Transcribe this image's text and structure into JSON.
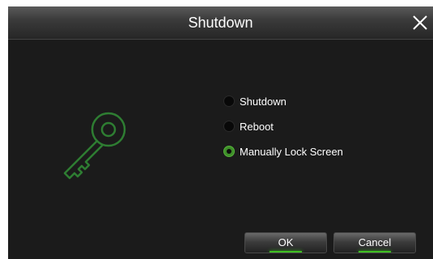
{
  "dialog": {
    "title": "Shutdown",
    "close_icon": "close-icon"
  },
  "illustration": {
    "icon": "key-icon",
    "color": "#2e7d32"
  },
  "options": [
    {
      "label": "Shutdown",
      "checked": false
    },
    {
      "label": "Reboot",
      "checked": false
    },
    {
      "label": "Manually Lock Screen",
      "checked": true
    }
  ],
  "buttons": {
    "ok_label": "OK",
    "cancel_label": "Cancel"
  },
  "colors": {
    "accent": "#3fc021",
    "background": "#1b1b1b"
  }
}
